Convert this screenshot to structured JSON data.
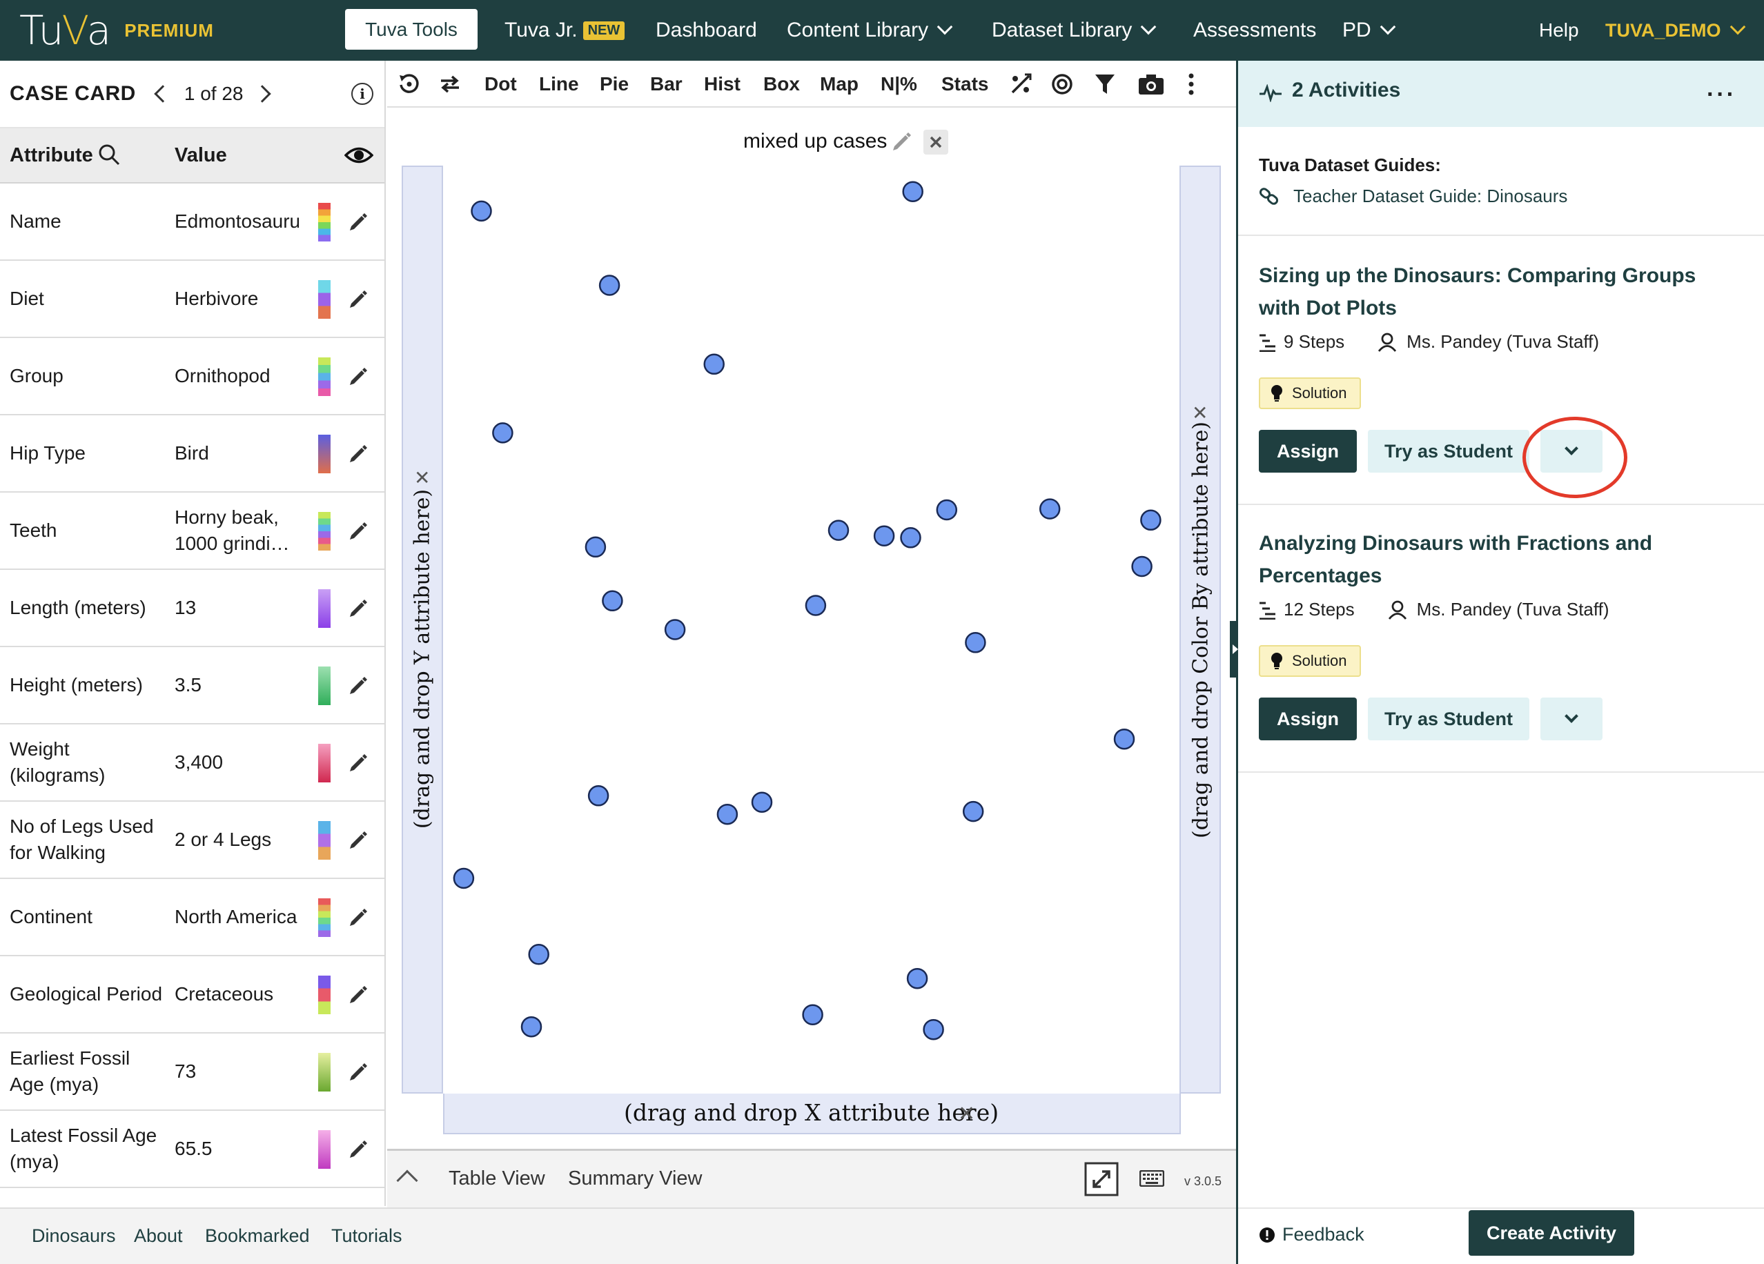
{
  "nav": {
    "logo_a": "Tu",
    "logo_v": "V",
    "logo_b": "a",
    "premium": "PREMIUM",
    "tuva_tools": "Tuva Tools",
    "tuva_jr": "Tuva Jr.",
    "new_badge": "NEW",
    "dashboard": "Dashboard",
    "content_library": "Content Library",
    "dataset_library": "Dataset Library",
    "assessments": "Assessments",
    "pd": "PD",
    "help": "Help",
    "user": "TUVA_DEMO"
  },
  "case_card": {
    "title": "CASE CARD",
    "count": "1 of 28",
    "col_attribute": "Attribute",
    "col_value": "Value",
    "rows": [
      {
        "attr": "Name",
        "value": "Edmontosauru",
        "colors": [
          "#e94b4b",
          "#f2a33a",
          "#f4e24a",
          "#7bd75a",
          "#4ab7e8",
          "#8b6cf0"
        ]
      },
      {
        "attr": "Diet",
        "value": "Herbivore",
        "colors": [
          "#6fd7e8",
          "#9c63e8",
          "#e3744e"
        ]
      },
      {
        "attr": "Group",
        "value": "Ornithopod",
        "colors": [
          "#c8e85a",
          "#6ed98a",
          "#5ab3e8",
          "#9c6ae8",
          "#e85aa8"
        ]
      },
      {
        "attr": "Hip Type",
        "value": "Bird",
        "colors": [
          "#5b5fe0",
          "#e06e4a"
        ]
      },
      {
        "attr": "Teeth",
        "value": "Horny beak, 1000 grindi…",
        "colors": [
          "#c8e85a",
          "#6ed98a",
          "#5ab3e8",
          "#9c6ae8",
          "#e85a8a",
          "#e8a65a"
        ]
      },
      {
        "attr": "Length (meters)",
        "value": "13",
        "colors": [
          "#c9a0f5",
          "#8b3fe8"
        ]
      },
      {
        "attr": "Height (meters)",
        "value": "3.5",
        "colors": [
          "#9de0b0",
          "#2fae5a"
        ]
      },
      {
        "attr": "Weight (kilograms)",
        "value": "3,400",
        "colors": [
          "#f5a0c0",
          "#d0284f"
        ]
      },
      {
        "attr": "No of Legs Used for Walking",
        "value": "2 or 4 Legs",
        "colors": [
          "#5ab3e8",
          "#b070e8",
          "#e8a65a"
        ]
      },
      {
        "attr": "Continent",
        "value": "North America",
        "colors": [
          "#e85a5a",
          "#e8a65a",
          "#c8e85a",
          "#6ed98a",
          "#5ab3e8",
          "#9c6ae8"
        ]
      },
      {
        "attr": "Geological Period",
        "value": "Cretaceous",
        "colors": [
          "#7a5ae8",
          "#e85a6a",
          "#c8e85a"
        ]
      },
      {
        "attr": "Earliest Fossil Age (mya)",
        "value": "73",
        "colors": [
          "#e6f0a0",
          "#6aa830"
        ]
      },
      {
        "attr": "Latest Fossil Age (mya)",
        "value": "65.5",
        "colors": [
          "#f5b0e8",
          "#c03ac0"
        ]
      }
    ]
  },
  "toolbar": {
    "dot": "Dot",
    "line": "Line",
    "pie": "Pie",
    "bar": "Bar",
    "hist": "Hist",
    "box": "Box",
    "map": "Map",
    "n_pct": "N|%",
    "stats": "Stats"
  },
  "graph": {
    "title": "mixed up cases",
    "y_drop": "(drag and drop Y attribute here)",
    "x_drop": "(drag and drop X attribute here)",
    "color_drop": "(drag and drop Color By attribute here)",
    "point_color": "#6d97ee",
    "points": [
      [
        0.052,
        0.049
      ],
      [
        0.638,
        0.028
      ],
      [
        0.226,
        0.129
      ],
      [
        0.368,
        0.214
      ],
      [
        0.081,
        0.288
      ],
      [
        0.207,
        0.411
      ],
      [
        0.537,
        0.393
      ],
      [
        0.599,
        0.399
      ],
      [
        0.635,
        0.401
      ],
      [
        0.684,
        0.371
      ],
      [
        0.824,
        0.37
      ],
      [
        0.961,
        0.382
      ],
      [
        0.949,
        0.432
      ],
      [
        0.23,
        0.469
      ],
      [
        0.315,
        0.5
      ],
      [
        0.506,
        0.474
      ],
      [
        0.723,
        0.514
      ],
      [
        0.925,
        0.618
      ],
      [
        0.211,
        0.679
      ],
      [
        0.386,
        0.699
      ],
      [
        0.433,
        0.686
      ],
      [
        0.72,
        0.696
      ],
      [
        0.028,
        0.768
      ],
      [
        0.13,
        0.85
      ],
      [
        0.644,
        0.876
      ],
      [
        0.12,
        0.928
      ],
      [
        0.502,
        0.915
      ],
      [
        0.666,
        0.931
      ]
    ]
  },
  "graph_footer": {
    "table_view": "Table View",
    "summary_view": "Summary View",
    "version": "v 3.0.5"
  },
  "bottom_bar": {
    "dinosaurs": "Dinosaurs",
    "about": "About",
    "bookmarked": "Bookmarked",
    "tutorials": "Tutorials"
  },
  "right_panel": {
    "header_title": "2 Activities",
    "guides_title": "Tuva Dataset Guides:",
    "guide_link": "Teacher Dataset Guide: Dinosaurs",
    "activities": [
      {
        "title": "Sizing up the Dinosaurs: Comparing Groups with Dot Plots",
        "steps": "9 Steps",
        "author": "Ms. Pandey (Tuva Staff)",
        "badge": "Solution",
        "assign": "Assign",
        "try": "Try as Student"
      },
      {
        "title": "Analyzing Dinosaurs with Fractions and Percentages",
        "steps": "12 Steps",
        "author": "Ms. Pandey (Tuva Staff)",
        "badge": "Solution",
        "assign": "Assign",
        "try": "Try as Student"
      }
    ],
    "feedback": "Feedback",
    "create_activity": "Create Activity"
  }
}
